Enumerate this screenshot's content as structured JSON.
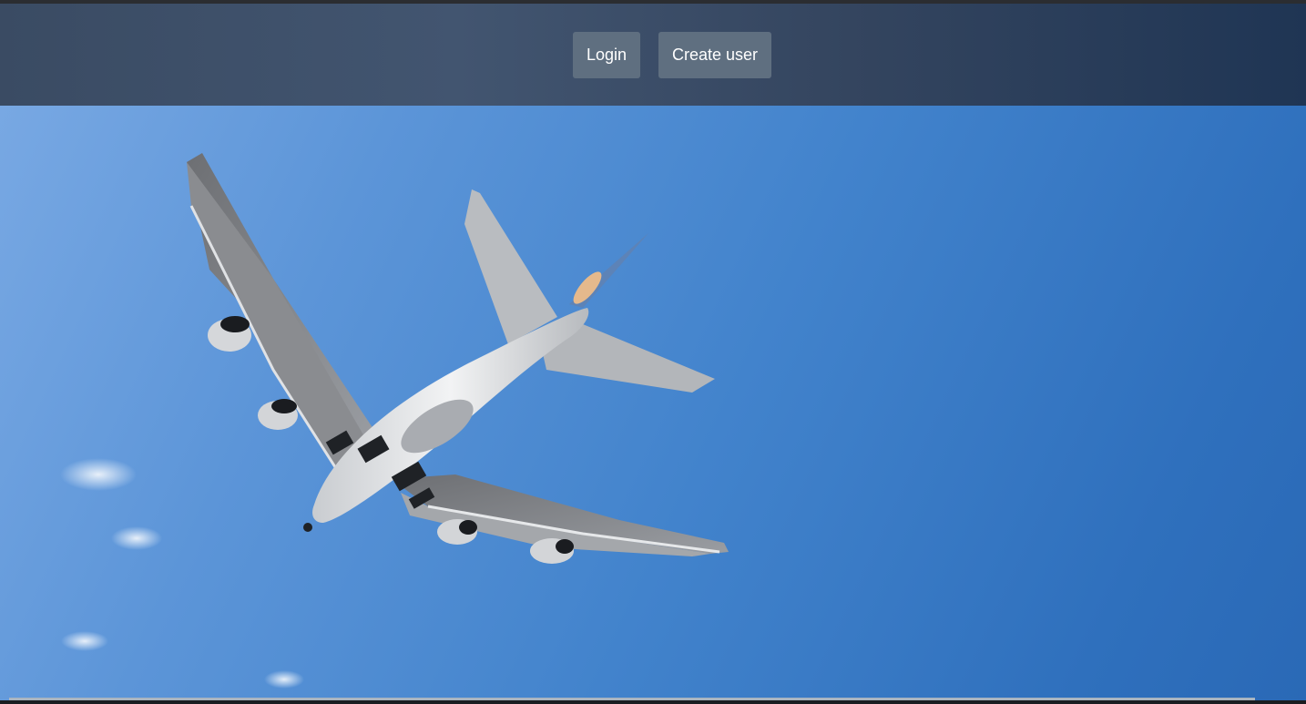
{
  "header": {
    "buttons": {
      "login": "Login",
      "create_user": "Create user"
    }
  },
  "hero": {
    "image": "airliner-in-blue-sky"
  }
}
